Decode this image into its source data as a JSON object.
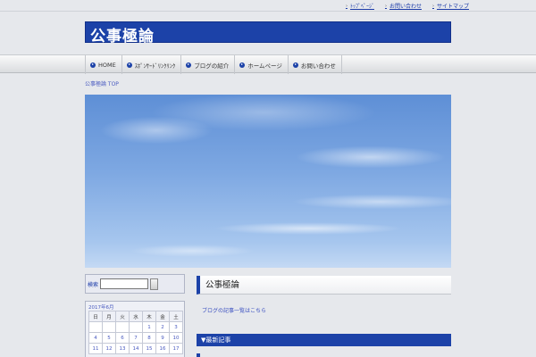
{
  "toplinks": [
    "ﾄｯﾌﾟﾍﾟｰｼﾞ",
    "お問い合わせ",
    "サイトマップ"
  ],
  "logo": {
    "text": "公事極論"
  },
  "nav": [
    "HOME",
    "ｽﾎﾟﾝｻｰﾄﾞﾘﾝｸﾘﾝｸ",
    "ブログの紹介",
    "ホームページ",
    "お問い合わせ"
  ],
  "breadcrumb": "公事極論 TOP",
  "search": {
    "label": "検索"
  },
  "calendar": {
    "title": "2017年6月",
    "weekdays": [
      "日",
      "月",
      "火",
      "水",
      "木",
      "金",
      "土"
    ],
    "rows": [
      [
        "",
        "",
        "",
        "",
        "1",
        "2",
        "3"
      ],
      [
        "4",
        "5",
        "6",
        "7",
        "8",
        "9",
        "10"
      ],
      [
        "11",
        "12",
        "13",
        "14",
        "15",
        "16",
        "17"
      ]
    ]
  },
  "page": {
    "title": "公事極論",
    "link": "ブログの記事一覧はこちら",
    "section": "▼最新記事"
  }
}
